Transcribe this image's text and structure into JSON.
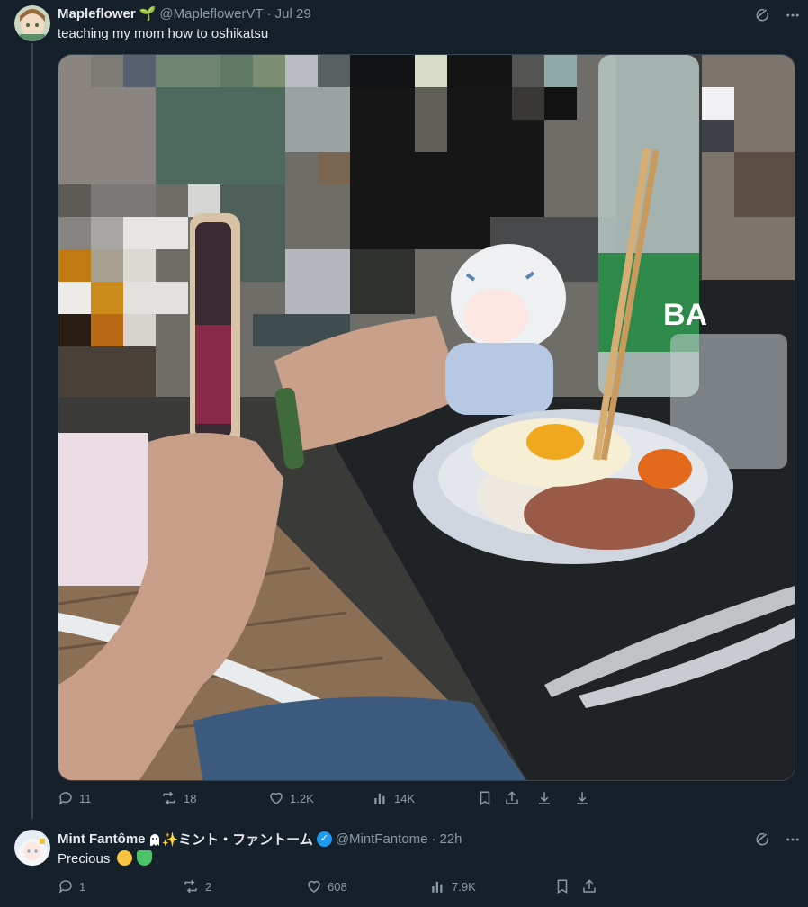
{
  "tweet1": {
    "display_name": "Mapleflower",
    "name_emoji": "🌱",
    "handle": "@MapleflowerVT",
    "separator": "·",
    "date": "Jul 29",
    "text": "teaching my mom how to oshikatsu",
    "media_alt": "Hands holding a plush doll and a phone next to a plate of rice with fried egg and chopsticks",
    "stats": {
      "replies": "11",
      "reposts": "18",
      "likes": "1.2K",
      "views": "14K"
    }
  },
  "tweet2": {
    "display_name": "Mint Fantôme",
    "name_suffix": "✨ミント・ファントーム",
    "verified": "✓",
    "handle": "@MintFantome",
    "separator": "·",
    "time": "22h",
    "text": "Precious",
    "stats": {
      "replies": "1",
      "reposts": "2",
      "likes": "608",
      "views": "7.9K"
    }
  },
  "icons": {
    "grok": "grok-icon",
    "more": "more-icon",
    "reply": "reply-icon",
    "repost": "repost-icon",
    "like": "like-icon",
    "views": "views-icon",
    "bookmark": "bookmark-icon",
    "share": "share-icon",
    "download": "download-icon"
  },
  "colors": {
    "background": "#15202b",
    "muted": "#8b98a5",
    "text": "#e7e9ea",
    "verified": "#1d9bf0",
    "divider": "#38444d"
  }
}
